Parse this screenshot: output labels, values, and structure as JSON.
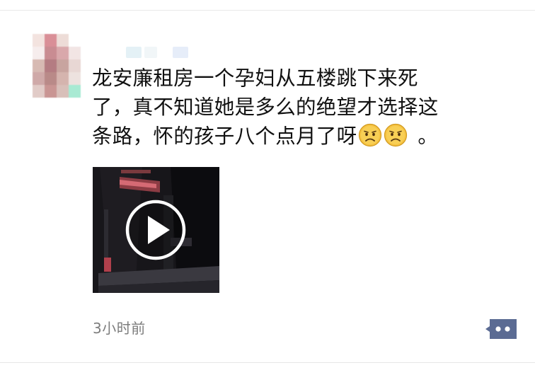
{
  "post": {
    "text_lines": [
      "龙安廉租房一个孕妇从五楼跳下来死",
      "了，真不知道她是多么的绝望才选择这",
      "条路，怀的孩子八个点月了呀"
    ],
    "trailing_emojis": [
      "sad-face-icon",
      "sad-face-icon"
    ],
    "trailing_punctuation": "。",
    "timestamp": "3小时前"
  },
  "colors": {
    "text": "#111111",
    "timestamp": "#7d7d7d",
    "comment_button": "#5b6b93",
    "emoji_face": "#f6c343"
  }
}
